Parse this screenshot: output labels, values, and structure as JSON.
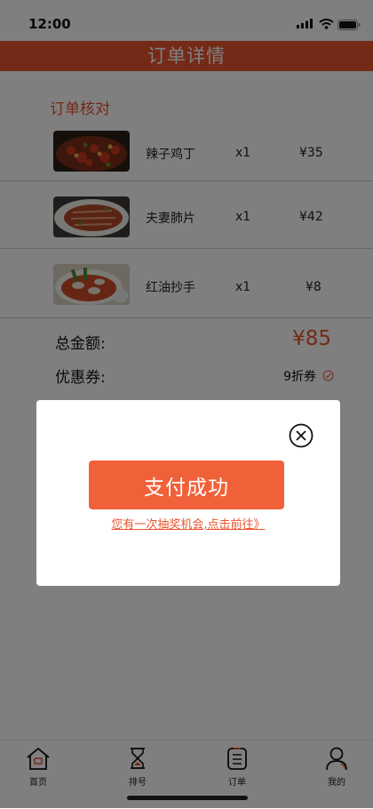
{
  "status_bar": {
    "time": "12:00"
  },
  "header": {
    "title": "订单详情"
  },
  "order": {
    "section_title": "订单核对",
    "items": [
      {
        "name": "辣子鸡丁",
        "qty": "x1",
        "price": "¥35",
        "image": "spicy-chicken-dish"
      },
      {
        "name": "夫妻肺片",
        "qty": "x1",
        "price": "¥42",
        "image": "sliced-beef-dish"
      },
      {
        "name": "红油抄手",
        "qty": "x1",
        "price": "¥8",
        "image": "chili-oil-wonton-dish"
      }
    ],
    "total_label": "总金额:",
    "total_value": "¥85",
    "coupon_label": "优惠券:",
    "coupon_value": "9折券"
  },
  "modal": {
    "pay_success": "支付成功",
    "lottery_link": "您有一次抽奖机会,点击前往》"
  },
  "tabbar": {
    "items": [
      {
        "label": "首页",
        "icon": "home-icon"
      },
      {
        "label": "排号",
        "icon": "hourglass-icon"
      },
      {
        "label": "订单",
        "icon": "order-list-icon"
      },
      {
        "label": "我的",
        "icon": "profile-icon"
      }
    ]
  },
  "colors": {
    "accent": "#e8552f",
    "button": "#f0613a"
  }
}
